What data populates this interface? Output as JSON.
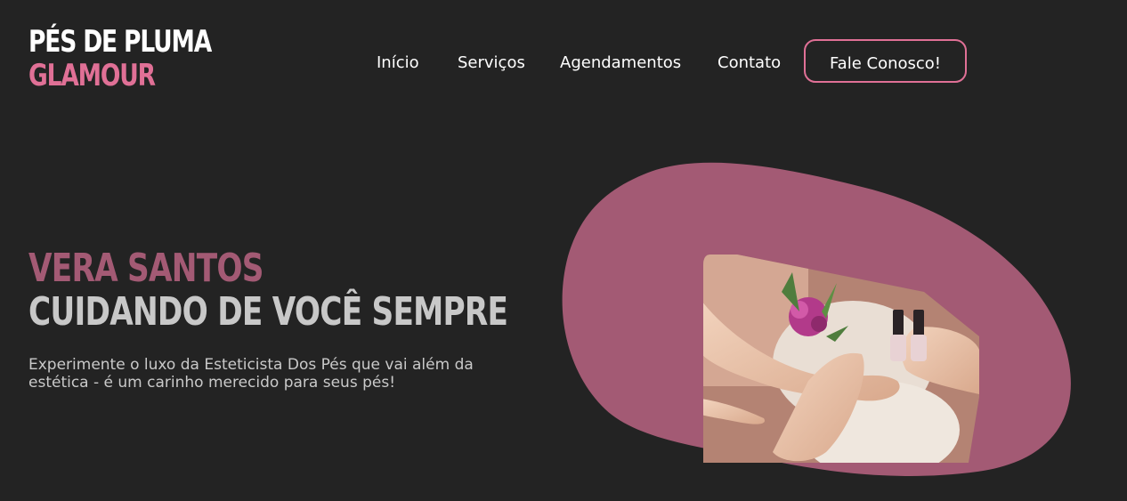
{
  "brand": {
    "line1": "PÉS DE PLUMA",
    "line2": "GLAMOUR",
    "accent_color": "#e07096"
  },
  "nav": {
    "items": [
      {
        "label": "Início"
      },
      {
        "label": "Serviços"
      },
      {
        "label": "Agendamentos"
      },
      {
        "label": "Contato"
      }
    ],
    "cta_label": "Fale Conosco!"
  },
  "hero": {
    "name": "VERA SANTOS",
    "tagline": "CUIDANDO DE VOCÊ SEMPRE",
    "description": "Experimente o luxo da Esteticista Dos Pés que vai além da estética - é um carinho merecido para seus pés!",
    "blob_color": "#a35a74",
    "image_subject": "pedicure-photo"
  }
}
